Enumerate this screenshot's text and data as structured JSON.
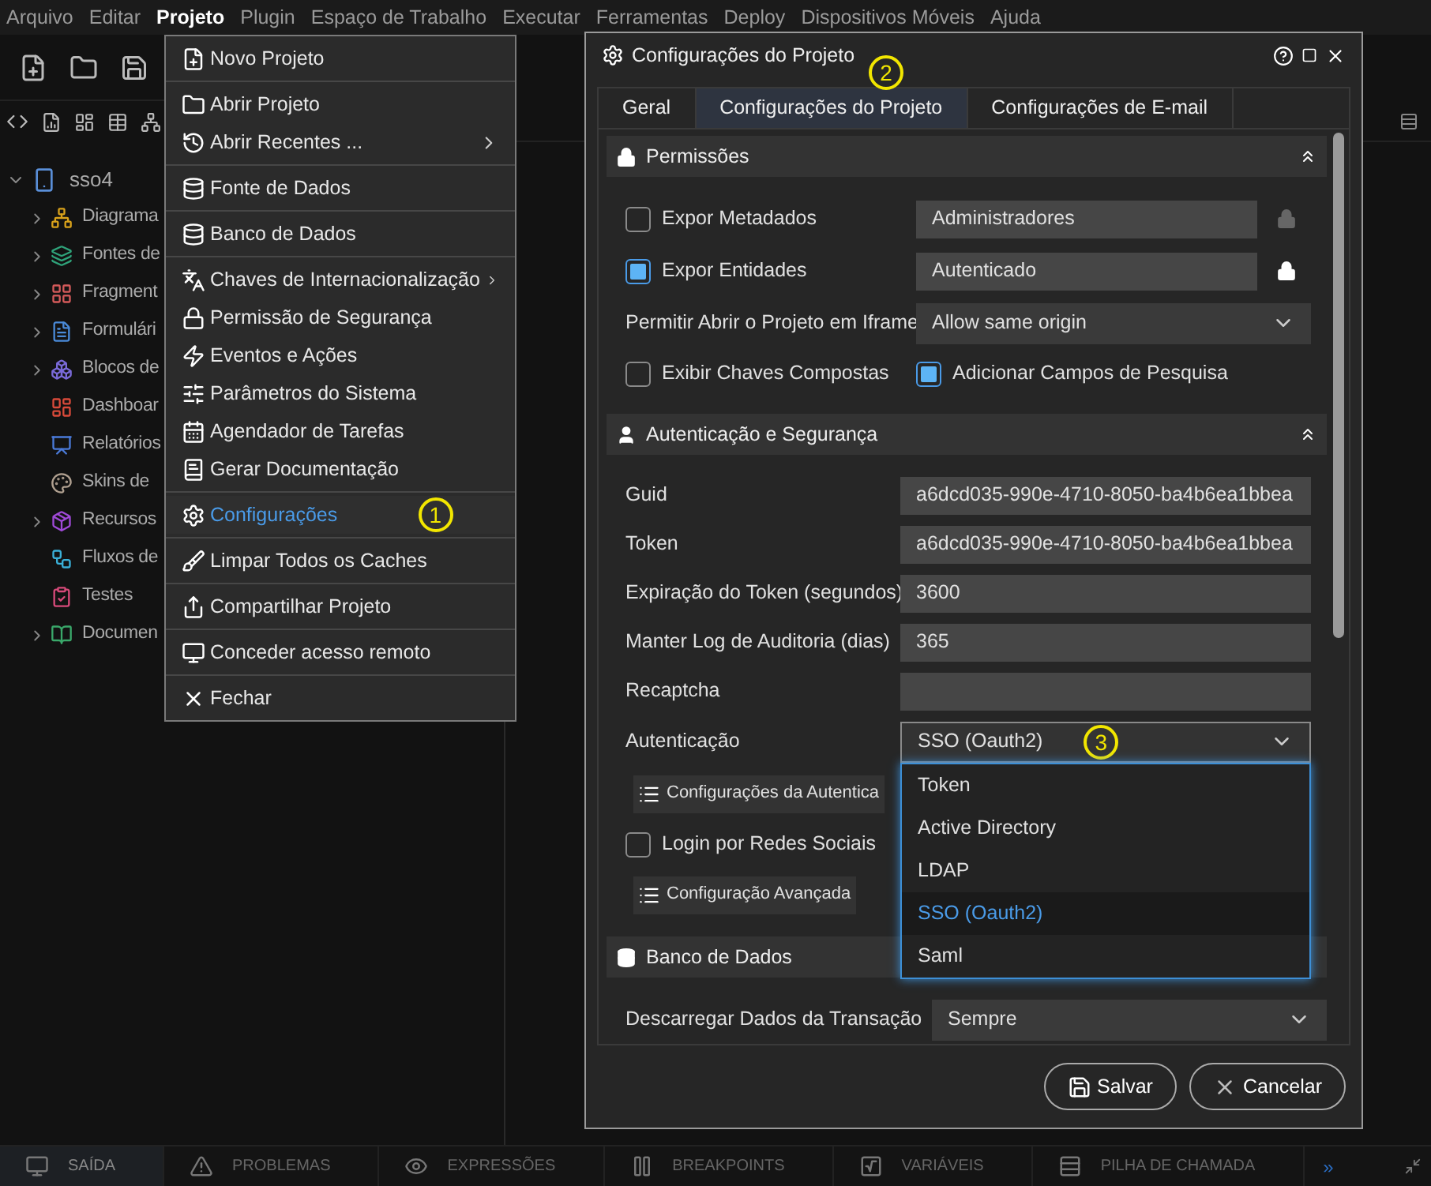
{
  "menu_bar": [
    {
      "label": "Arquivo",
      "selected": false
    },
    {
      "label": "Editar",
      "selected": false
    },
    {
      "label": "Projeto",
      "selected": true
    },
    {
      "label": "Plugin",
      "selected": false
    },
    {
      "label": "Espaço de Trabalho",
      "selected": false
    },
    {
      "label": "Executar",
      "selected": false
    },
    {
      "label": "Ferramentas",
      "selected": false
    },
    {
      "label": "Deploy",
      "selected": false
    },
    {
      "label": "Dispositivos Móveis",
      "selected": false
    },
    {
      "label": "Ajuda",
      "selected": false
    }
  ],
  "project_tree": {
    "label": "sso4",
    "expanded": true,
    "children": [
      {
        "label": "Diagrama",
        "expandable": true
      },
      {
        "label": "Fontes de",
        "expandable": true
      },
      {
        "label": "Fragment",
        "expandable": true
      },
      {
        "label": "Formulári",
        "expandable": true
      },
      {
        "label": "Blocos de",
        "expandable": true
      },
      {
        "label": "Dashboar",
        "expandable": false
      },
      {
        "label": "Relatórios",
        "expandable": false
      },
      {
        "label": "Skins de",
        "expandable": false
      },
      {
        "label": "Recursos",
        "expandable": true
      },
      {
        "label": "Fluxos de",
        "expandable": false
      },
      {
        "label": "Testes",
        "expandable": false
      },
      {
        "label": "Documen",
        "expandable": true
      }
    ]
  },
  "project_menu": [
    [
      {
        "label": "Novo Projeto",
        "submenu": false,
        "selected": false
      }
    ],
    [
      {
        "label": "Abrir Projeto",
        "submenu": false,
        "selected": false
      },
      {
        "label": "Abrir Recentes ...",
        "submenu": true,
        "selected": false
      }
    ],
    [
      {
        "label": "Fonte de Dados",
        "submenu": false,
        "selected": false
      }
    ],
    [
      {
        "label": "Banco de Dados",
        "submenu": false,
        "selected": false
      }
    ],
    [
      {
        "label": "Chaves de Internacionalização",
        "submenu": true,
        "selected": false
      },
      {
        "label": "Permissão de Segurança",
        "submenu": false,
        "selected": false
      },
      {
        "label": "Eventos e Ações",
        "submenu": false,
        "selected": false
      },
      {
        "label": "Parâmetros do Sistema",
        "submenu": false,
        "selected": false
      },
      {
        "label": "Agendador de Tarefas",
        "submenu": false,
        "selected": false
      },
      {
        "label": "Gerar Documentação",
        "submenu": false,
        "selected": false
      }
    ],
    [
      {
        "label": "Configurações",
        "submenu": false,
        "selected": true,
        "marker": "1"
      }
    ],
    [
      {
        "label": "Limpar Todos os Caches",
        "submenu": false,
        "selected": false
      }
    ],
    [
      {
        "label": "Compartilhar Projeto",
        "submenu": false,
        "selected": false
      }
    ],
    [
      {
        "label": "Conceder acesso remoto",
        "submenu": false,
        "selected": false
      }
    ],
    [
      {
        "label": "Fechar",
        "submenu": false,
        "selected": false
      }
    ]
  ],
  "dialog": {
    "title": "Configurações do Projeto",
    "marker": "2",
    "tabs": [
      {
        "label": "Geral",
        "selected": false
      },
      {
        "label": "Configurações do Projeto",
        "selected": true
      },
      {
        "label": "Configurações de E-mail",
        "selected": false
      }
    ],
    "sections": [
      {
        "title": "Permissões",
        "rows": [
          {
            "kind": "check_field",
            "label": "Expor Metadados",
            "checked": false,
            "value": "Administradores",
            "lock_enabled": false
          },
          {
            "kind": "check_field",
            "label": "Expor Entidades",
            "checked": true,
            "value": "Autenticado",
            "lock_enabled": true
          },
          {
            "kind": "select",
            "label": "Permitir Abrir o Projeto em Iframe",
            "value": "Allow same origin"
          },
          {
            "kind": "check_pair",
            "items": [
              {
                "label": "Exibir Chaves Compostas",
                "checked": false
              },
              {
                "label": "Adicionar Campos de Pesquisa",
                "checked": true
              }
            ]
          }
        ]
      },
      {
        "title": "Autenticação e Segurança",
        "rows": [
          {
            "kind": "field",
            "label": "Guid",
            "value": "a6dcd035-990e-4710-8050-ba4b6ea1bbea"
          },
          {
            "kind": "field",
            "label": "Token",
            "value": "a6dcd035-990e-4710-8050-ba4b6ea1bbea"
          },
          {
            "kind": "field",
            "label": "Expiração do Token (segundos)",
            "value": "3600"
          },
          {
            "kind": "field",
            "label": "Manter Log de Auditoria (dias)",
            "value": "365"
          },
          {
            "kind": "field",
            "label": "Recaptcha"
          },
          {
            "kind": "select",
            "label": "Autenticação",
            "value": "SSO (Oauth2)",
            "expanded": true,
            "marker": "3",
            "options": [
              {
                "label": "Token",
                "selected": false
              },
              {
                "label": "Active Directory",
                "selected": false
              },
              {
                "label": "LDAP",
                "selected": false
              },
              {
                "label": "SSO (Oauth2)",
                "selected": true
              },
              {
                "label": "Saml",
                "selected": false
              }
            ]
          },
          {
            "kind": "button",
            "label": "Configurações da Autentica"
          },
          {
            "kind": "checkbox",
            "label": "Login por Redes Sociais",
            "checked": false
          },
          {
            "kind": "button",
            "label": "Configuração Avançada"
          }
        ]
      },
      {
        "title": "Banco de Dados",
        "rows": [
          {
            "kind": "select",
            "label": "Descarregar Dados da Transação",
            "value": "Sempre"
          }
        ]
      }
    ],
    "buttons": [
      {
        "label": "Salvar",
        "kind": "save"
      },
      {
        "label": "Cancelar",
        "kind": "cancel"
      }
    ]
  },
  "bottom_tabs": [
    {
      "label": "SAÍDA",
      "selected": true
    },
    {
      "label": "PROBLEMAS",
      "selected": false
    },
    {
      "label": "EXPRESSÕES",
      "selected": false
    },
    {
      "label": "BREAKPOINTS",
      "selected": false
    },
    {
      "label": "VARIÁVEIS",
      "selected": false
    },
    {
      "label": "PILHA DE CHAMADA",
      "selected": false
    }
  ],
  "overflow_button": "»"
}
